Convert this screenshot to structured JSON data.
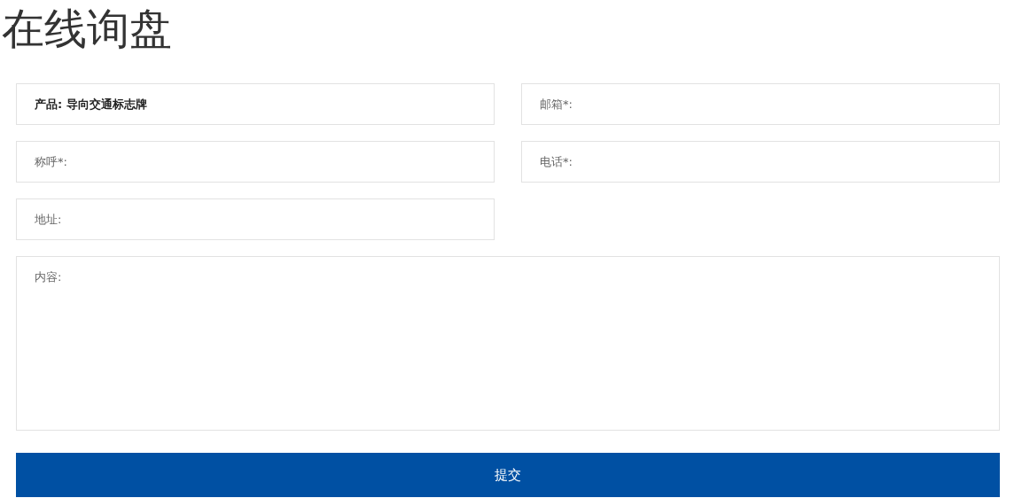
{
  "title": "在线询盘",
  "fields": [
    {
      "value": "产品: 导向交通标志牌"
    },
    {
      "placeholder": "邮箱*:"
    },
    {
      "placeholder": "称呼*:"
    },
    {
      "placeholder": "电话*:"
    },
    {
      "placeholder": "地址:"
    }
  ],
  "content": {
    "placeholder": "内容:"
  },
  "submit": "提交"
}
